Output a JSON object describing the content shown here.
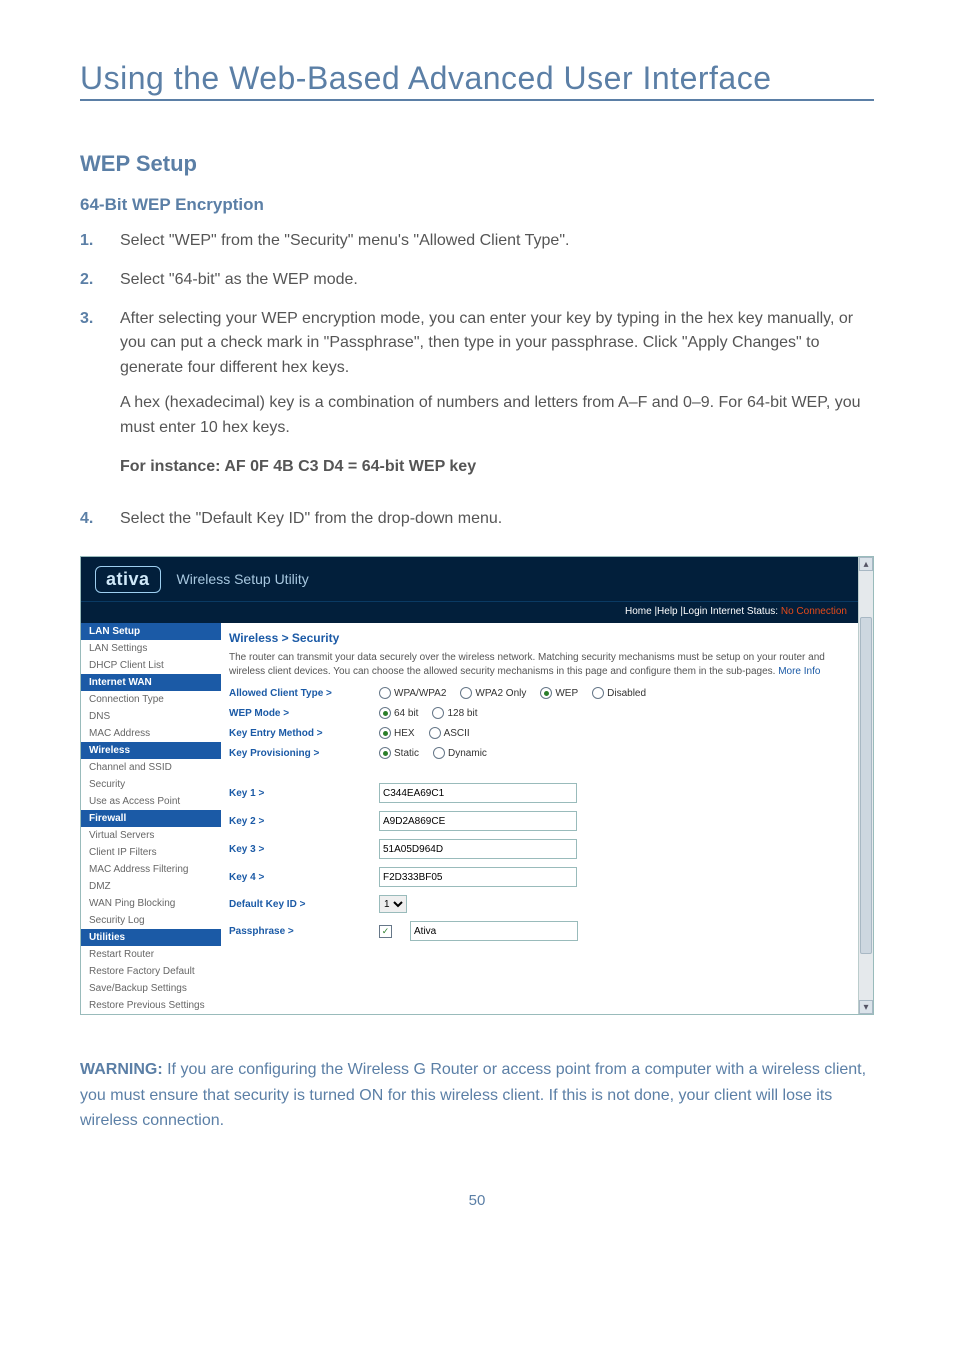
{
  "page": {
    "title": "Using the Web-Based Advanced User Interface",
    "h2": "WEP Setup",
    "h3": "64-Bit WEP Encryption",
    "number": "50"
  },
  "steps": {
    "s1_num": "1.",
    "s1": "Select \"WEP\" from the \"Security\" menu's \"Allowed Client Type\".",
    "s2_num": "2.",
    "s2": "Select \"64-bit\" as the WEP mode.",
    "s3_num": "3.",
    "s3": "After selecting your WEP encryption mode, you can enter your key by typing in the hex key manually, or you can put a check mark in \"Passphrase\", then type in your passphrase. Click \"Apply Changes\" to generate four different hex keys.",
    "s3_para": "A hex (hexadecimal) key is a combination of numbers and letters from A–F and 0–9. For 64-bit WEP, you must enter 10 hex keys.",
    "s3_bold": "For instance:  AF 0F 4B C3 D4 = 64-bit WEP key",
    "s4_num": "4.",
    "s4": "Select the \"Default Key ID\" from the drop-down menu."
  },
  "warning": {
    "label": "WARNING:",
    "text": " If you are configuring the Wireless G Router or access point from a computer with a wireless client, you must ensure that security is turned ON for this wireless client. If this is not done, your client will lose its wireless connection."
  },
  "shot": {
    "logo": "ativa",
    "hdr_title": "Wireless Setup Utility",
    "subbar_links": "Home |Help |Login",
    "subbar_status_lbl": "   Internet Status:",
    "subbar_status_val": "No Connection",
    "nav": {
      "g1": "LAN Setup",
      "g1a": "LAN Settings",
      "g1b": "DHCP Client List",
      "g2": "Internet WAN",
      "g2a": "Connection Type",
      "g2b": "DNS",
      "g2c": "MAC Address",
      "g3": "Wireless",
      "g3a": "Channel and SSID",
      "g3b": "Security",
      "g3c": "Use as Access Point",
      "g4": "Firewall",
      "g4a": "Virtual Servers",
      "g4b": "Client IP Filters",
      "g4c": "MAC Address Filtering",
      "g4d": "DMZ",
      "g4e": "WAN Ping Blocking",
      "g4f": "Security Log",
      "g5": "Utilities",
      "g5a": "Restart Router",
      "g5b": "Restore Factory Default",
      "g5c": "Save/Backup Settings",
      "g5d": "Restore Previous Settings"
    },
    "crumb": "Wireless > Security",
    "desc": "The router can transmit your data securely over the wireless network. Matching security mechanisms must be setup on your router and wireless client devices. You can choose the allowed security mechanisms in this page and configure them in the sub-pages. ",
    "desc_more": "More Info",
    "rows": {
      "r1": "Allowed Client Type >",
      "r1a": "WPA/WPA2",
      "r1b": "WPA2 Only",
      "r1c": "WEP",
      "r1d": "Disabled",
      "r2": "WEP Mode >",
      "r2a": "64 bit",
      "r2b": "128 bit",
      "r3": "Key Entry Method >",
      "r3a": "HEX",
      "r3b": "ASCII",
      "r4": "Key Provisioning >",
      "r4a": "Static",
      "r4b": "Dynamic",
      "k1": "Key 1 >",
      "k1v": "C344EA69C1",
      "k2": "Key 2 >",
      "k2v": "A9D2A869CE",
      "k3": "Key 3 >",
      "k3v": "51A05D964D",
      "k4": "Key 4 >",
      "k4v": "F2D333BF05",
      "dk": "Default Key ID >",
      "dkv": "1",
      "pp": "Passphrase >",
      "ppv": "Ativa"
    }
  }
}
